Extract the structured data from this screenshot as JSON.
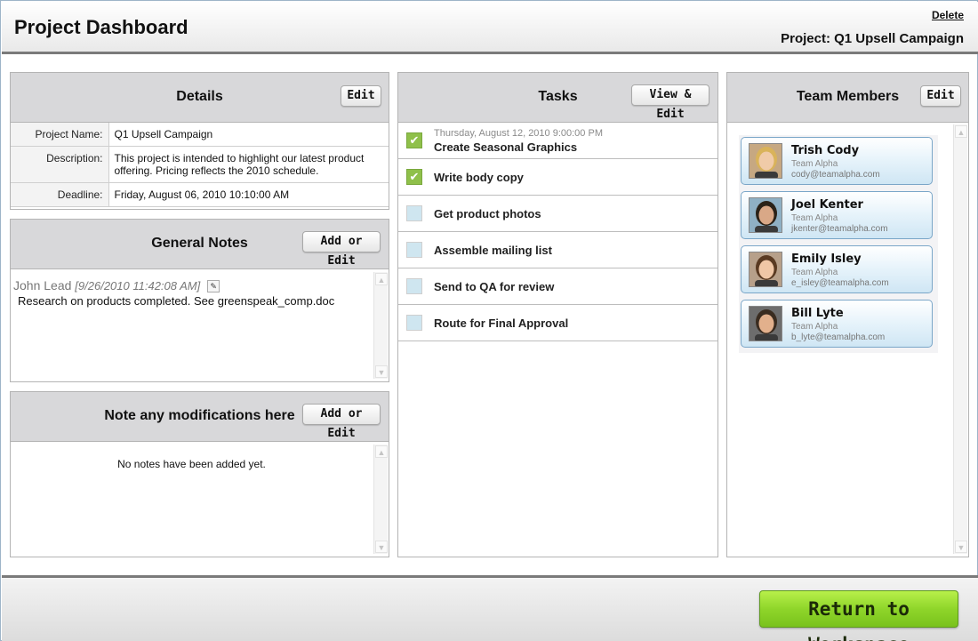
{
  "header": {
    "title": "Project Dashboard",
    "delete_label": "Delete",
    "project_label": "Project: Q1 Upsell Campaign"
  },
  "details": {
    "title": "Details",
    "edit_label": "Edit",
    "rows": [
      {
        "label": "Project Name:",
        "value": "Q1 Upsell Campaign"
      },
      {
        "label": "Description:",
        "value": "This project is intended to highlight our latest product offering. Pricing reflects the 2010 schedule."
      },
      {
        "label": "Deadline:",
        "value": "Friday, August 06, 2010 10:10:00 AM"
      }
    ]
  },
  "general_notes": {
    "title": "General Notes",
    "button_label": "Add or Edit",
    "entries": [
      {
        "author": "John Lead",
        "timestamp": "[9/26/2010 11:42:08 AM]",
        "text": "Research on products completed. See greenspeak_comp.doc"
      }
    ]
  },
  "modifications": {
    "title": "Note any modifications here",
    "button_label": "Add or Edit",
    "empty_text": "No notes have been added yet."
  },
  "tasks": {
    "title": "Tasks",
    "button_label": "View & Edit",
    "items": [
      {
        "date": "Thursday, August 12, 2010 9:00:00 PM",
        "label": "Create Seasonal Graphics",
        "done": true
      },
      {
        "date": "",
        "label": "Write body copy",
        "done": true
      },
      {
        "date": "",
        "label": "Get product photos",
        "done": false
      },
      {
        "date": "",
        "label": "Assemble mailing list",
        "done": false
      },
      {
        "date": "",
        "label": "Send to QA for review",
        "done": false
      },
      {
        "date": "",
        "label": "Route for Final Approval",
        "done": false
      }
    ]
  },
  "team": {
    "title": "Team Members",
    "edit_label": "Edit",
    "members": [
      {
        "name": "Trish Cody",
        "team": "Team Alpha",
        "email": "cody@teamalpha.com",
        "hair": "#d9b35a",
        "skin": "#f0cba8",
        "bg": "#c6a882"
      },
      {
        "name": "Joel Kenter",
        "team": "Team Alpha",
        "email": "jkenter@teamalpha.com",
        "hair": "#2b2218",
        "skin": "#d9a887",
        "bg": "#8fb0c4"
      },
      {
        "name": "Emily Isley",
        "team": "Team Alpha",
        "email": "e_isley@teamalpha.com",
        "hair": "#5a3a22",
        "skin": "#f0c7a6",
        "bg": "#b7a08a"
      },
      {
        "name": "Bill Lyte",
        "team": "Team Alpha",
        "email": "b_lyte@teamalpha.com",
        "hair": "#3a2c20",
        "skin": "#e2b08c",
        "bg": "#6d6d6d"
      }
    ]
  },
  "footer": {
    "return_label": "Return to Workspace"
  },
  "icons": {
    "checkmark": "check-icon",
    "scroll_up": "scroll-up-icon",
    "scroll_down": "scroll-down-icon",
    "note_edit": "pencil-icon"
  }
}
